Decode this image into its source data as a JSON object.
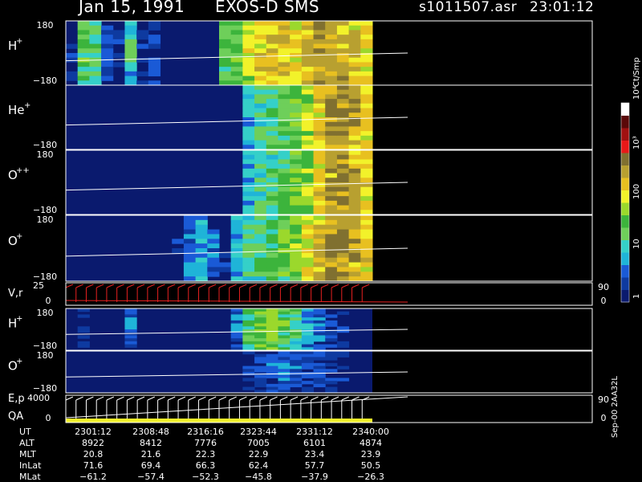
{
  "header": {
    "date": "Jan 15, 1991",
    "instrument": "EXOS-D SMS",
    "file": "s1011507.asr",
    "time": "23:01:12"
  },
  "colorbar": {
    "unit_label": "Ct/Smp",
    "tick_labels": [
      "1",
      "10",
      "100",
      "10³",
      "10⁴"
    ],
    "colors": [
      "#0a1a6e",
      "#0e3aa0",
      "#1a5ad6",
      "#1fb4d8",
      "#35d0c8",
      "#6ecf5a",
      "#3cb43c",
      "#9bd82c",
      "#f2f22a",
      "#e8c020",
      "#b8a030",
      "#807030",
      "#e81818",
      "#a01010",
      "#5a0808",
      "#ffffff"
    ]
  },
  "chart_data": [
    {
      "type": "heatmap",
      "panel": "H+",
      "ion_label": "H",
      "ion_charge": "+",
      "y_ticks": [
        "180",
        "−180"
      ],
      "ylim": [
        -180,
        180
      ],
      "intensity_ct_per_smp": [
        2,
        40,
        25,
        4,
        2,
        15,
        2,
        3,
        1,
        1,
        1,
        1,
        1,
        30,
        60,
        150,
        300,
        400,
        320,
        200,
        500,
        800,
        700,
        600,
        400,
        300
      ]
    },
    {
      "type": "heatmap",
      "panel": "He+",
      "ion_label": "He",
      "ion_charge": "+",
      "y_ticks": [
        "−180"
      ],
      "ylim": [
        -180,
        180
      ],
      "intensity_ct_per_smp": [
        1,
        1,
        1,
        1,
        1,
        1,
        1,
        1,
        1,
        1,
        1,
        1,
        1,
        1,
        1,
        10,
        20,
        30,
        40,
        60,
        120,
        300,
        700,
        800,
        600,
        300
      ]
    },
    {
      "type": "heatmap",
      "panel": "O++",
      "ion_label": "O",
      "ion_charge": "++",
      "y_ticks": [
        "180",
        "−180"
      ],
      "ylim": [
        -180,
        180
      ],
      "intensity_ct_per_smp": [
        1,
        1,
        1,
        1,
        1,
        1,
        1,
        1,
        1,
        1,
        1,
        1,
        1,
        1,
        1,
        10,
        20,
        30,
        40,
        60,
        120,
        300,
        600,
        700,
        500,
        300
      ]
    },
    {
      "type": "heatmap",
      "panel": "O+",
      "ion_label": "O",
      "ion_charge": "+",
      "y_ticks": [
        "180",
        "−180"
      ],
      "ylim": [
        -180,
        180
      ],
      "intensity_ct_per_smp": [
        1,
        1,
        1,
        1,
        1,
        1,
        1,
        1,
        1,
        2,
        5,
        10,
        4,
        2,
        10,
        20,
        30,
        40,
        60,
        100,
        200,
        400,
        700,
        800,
        600,
        300
      ]
    },
    {
      "type": "line",
      "panel": "V,r",
      "label": "V,r",
      "y_ticks": [
        "25",
        "0"
      ],
      "right_ticks": [
        "90",
        "0"
      ],
      "ylim": [
        0,
        25
      ]
    },
    {
      "type": "heatmap",
      "panel": "H+ (second)",
      "ion_label": "H",
      "ion_charge": "+",
      "y_ticks": [
        "180",
        "−180"
      ],
      "ylim": [
        -180,
        180
      ],
      "intensity_ct_per_smp": [
        1,
        2,
        1,
        1,
        1,
        5,
        1,
        1,
        1,
        1,
        1,
        1,
        1,
        1,
        5,
        40,
        60,
        80,
        50,
        30,
        10,
        5,
        3,
        2,
        1,
        1
      ]
    },
    {
      "type": "heatmap",
      "panel": "O+ (second)",
      "ion_label": "O",
      "ion_charge": "+",
      "y_ticks": [
        "180",
        "−180"
      ],
      "ylim": [
        -180,
        180
      ],
      "intensity_ct_per_smp": [
        1,
        1,
        1,
        1,
        1,
        1,
        1,
        1,
        1,
        1,
        1,
        1,
        1,
        1,
        1,
        2,
        3,
        4,
        5,
        4,
        3,
        3,
        2,
        2,
        1,
        1
      ]
    },
    {
      "type": "line",
      "panel": "E,p / QA",
      "label_top": "E,p",
      "label_bottom": "QA",
      "y_ticks": [
        "4000",
        "0"
      ],
      "right_ticks": [
        "90",
        "0"
      ],
      "ylim": [
        0,
        4000
      ]
    }
  ],
  "axis_table": {
    "rows": [
      {
        "label": "UT",
        "values": [
          "2301:12",
          "2308:48",
          "2316:16",
          "2323:44",
          "2331:12",
          "2340:00"
        ]
      },
      {
        "label": "ALT",
        "values": [
          "8922",
          "8412",
          "7776",
          "7005",
          "6101",
          "4874"
        ]
      },
      {
        "label": "MLT",
        "values": [
          "20.8",
          "21.6",
          "22.3",
          "22.9",
          "23.4",
          "23.9"
        ]
      },
      {
        "label": "InLat",
        "values": [
          "71.6",
          "69.4",
          "66.3",
          "62.4",
          "57.7",
          "50.5"
        ]
      },
      {
        "label": "MLat",
        "values": [
          "−61.2",
          "−57.4",
          "−52.3",
          "−45.8",
          "−37.9",
          "−26.3"
        ]
      }
    ]
  },
  "side_info": "Sep-00 2AA32L"
}
